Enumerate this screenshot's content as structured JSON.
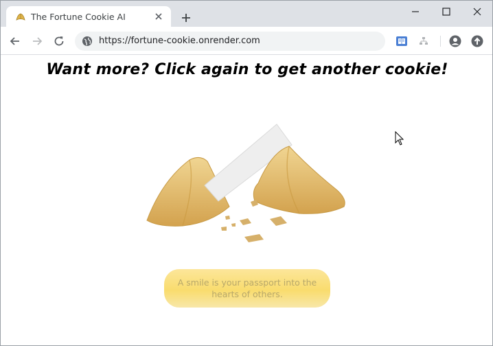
{
  "browser": {
    "tab_title": "The Fortune Cookie AI",
    "url": "https://fortune-cookie.onrender.com"
  },
  "page": {
    "headline": "Want more? Click again to get another cookie!",
    "fortune_text": "A smile is your passport into the hearts of others."
  },
  "colors": {
    "fortune_bg": "#f9dc6e",
    "fortune_text": "#b8a86a",
    "tabstrip_bg": "#dee1e6"
  }
}
